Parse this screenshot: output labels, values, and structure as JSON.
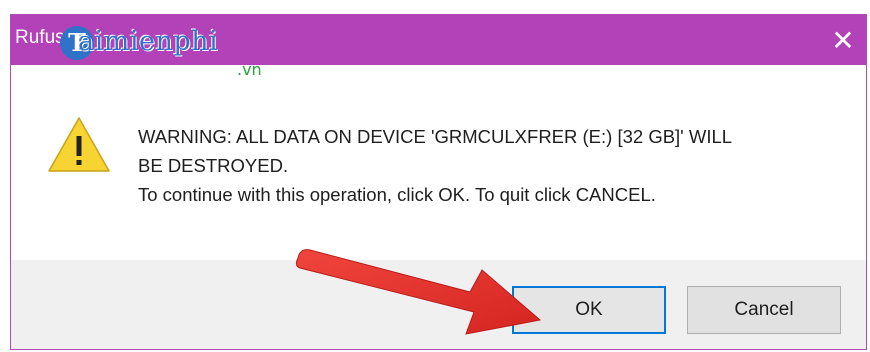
{
  "window": {
    "title": "Rufus",
    "close_glyph": "✕"
  },
  "message": {
    "line1": "WARNING: ALL DATA ON DEVICE 'GRMCULXFRER (E:) [32 GB]' WILL",
    "line2": "BE DESTROYED.",
    "line3": "To continue with this operation, click OK. To quit click CANCEL."
  },
  "buttons": {
    "ok_label": "OK",
    "cancel_label": "Cancel"
  },
  "watermark": {
    "letter": "T",
    "word": "aimienphi",
    "suffix": ".vn"
  },
  "icons": {
    "warning": "warning-triangle-icon",
    "close": "close-icon",
    "arrow": "red-pointer-arrow"
  },
  "colors": {
    "titlebar": "#b341b8",
    "footer": "#f0f0f0",
    "ok_border": "#0078d7",
    "arrow": "#e8322f",
    "warning_fill": "#f8d433"
  }
}
